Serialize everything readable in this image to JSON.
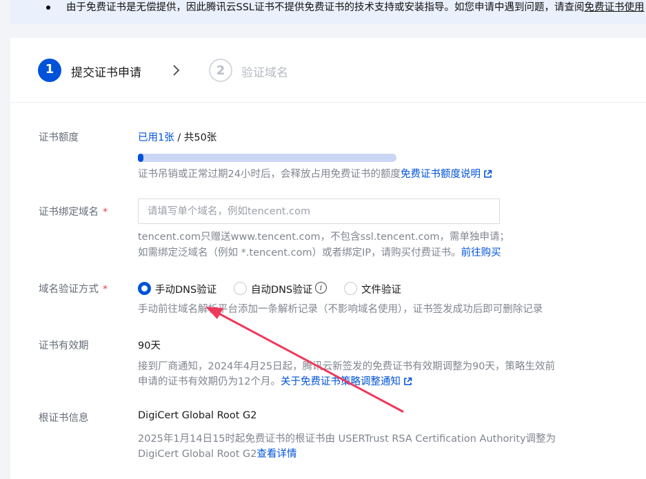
{
  "notice": {
    "text": "由于免费证书是无偿提供，因此腾讯云SSL证书不提供免费证书的技术支持或安装指导。如您申请中遇到问题，请查阅",
    "link": "免费证书使用"
  },
  "steps": [
    {
      "num": "1",
      "label": "提交证书申请"
    },
    {
      "num": "2",
      "label": "验证域名"
    }
  ],
  "quota": {
    "label": "证书额度",
    "used": "已用1张",
    "sep": " / ",
    "total": "共50张",
    "progress": 0.02,
    "hint": "证书吊销或正常过期24小时后，会释放占用免费证书的额度",
    "hint_link": "免费证书额度说明"
  },
  "domain": {
    "label": "证书绑定域名",
    "placeholder": "请填写单个域名，例如tencent.com",
    "hint1": "tencent.com只赠送www.tencent.com，不包含ssl.tencent.com，需单独申请；",
    "hint2": "如需绑定泛域名（例如 *.tencent.com）或者绑定IP，请购买付费证书。",
    "hint2_link": "前往购买"
  },
  "verify": {
    "label": "域名验证方式",
    "options": [
      "手动DNS验证",
      "自动DNS验证",
      "文件验证"
    ],
    "hint": "手动前往域名解析平台添加一条解析记录（不影响域名使用），证书签发成功后即可删除记录"
  },
  "validity": {
    "label": "证书有效期",
    "value": "90天",
    "hint1": "接到厂商通知，2024年4月25日起，腾讯云新签发的免费证书有效期调整为90天，策略生效前",
    "hint2": "申请的证书有效期仍为12个月。",
    "hint2_link": "关于免费证书策略调整通知"
  },
  "root": {
    "label": "根证书信息",
    "value": "DigiCert Global Root G2",
    "hint1": "2025年1月14日15时起免费证书的根证书由 USERTrust RSA Certification Authority调整为",
    "hint2": "DigiCert Global Root G2",
    "hint2_link": "查看详情"
  },
  "colors": {
    "accent": "#0052d9",
    "required": "#e54545",
    "annotation": "#f0385a"
  }
}
